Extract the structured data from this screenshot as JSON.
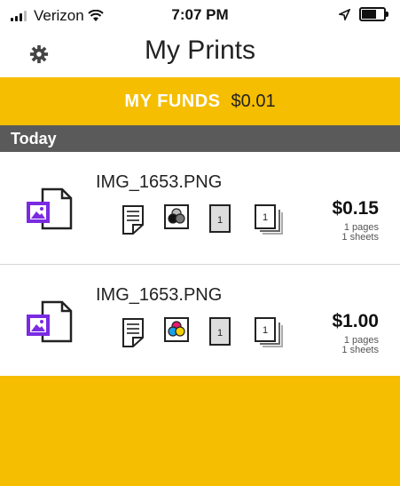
{
  "status_bar": {
    "carrier": "Verizon",
    "time": "7:07 PM",
    "icons": [
      "signal-icon",
      "wifi-icon",
      "location-arrow-icon",
      "battery-icon"
    ]
  },
  "header": {
    "title": "My Prints",
    "settings_icon": "gear-icon"
  },
  "funds": {
    "label": "MY FUNDS",
    "amount": "$0.01"
  },
  "section": {
    "title": "Today"
  },
  "prints": [
    {
      "filename": "IMG_1653.PNG",
      "price": "$0.15",
      "pages": "1 pages",
      "sheets": "1 sheets",
      "color_mode": "black-white",
      "option_icons": [
        "paper-size-icon",
        "color-mode-icon",
        "single-sided-icon",
        "copies-icon"
      ],
      "copies": "1"
    },
    {
      "filename": "IMG_1653.PNG",
      "price": "$1.00",
      "pages": "1 pages",
      "sheets": "1 sheets",
      "color_mode": "color",
      "option_icons": [
        "paper-size-icon",
        "color-mode-icon",
        "single-sided-icon",
        "copies-icon"
      ],
      "copies": "1"
    }
  ],
  "colors": {
    "accent": "#f6be00",
    "section_bg": "#5a5a5a",
    "file_icon_purple": "#7a2be2"
  }
}
